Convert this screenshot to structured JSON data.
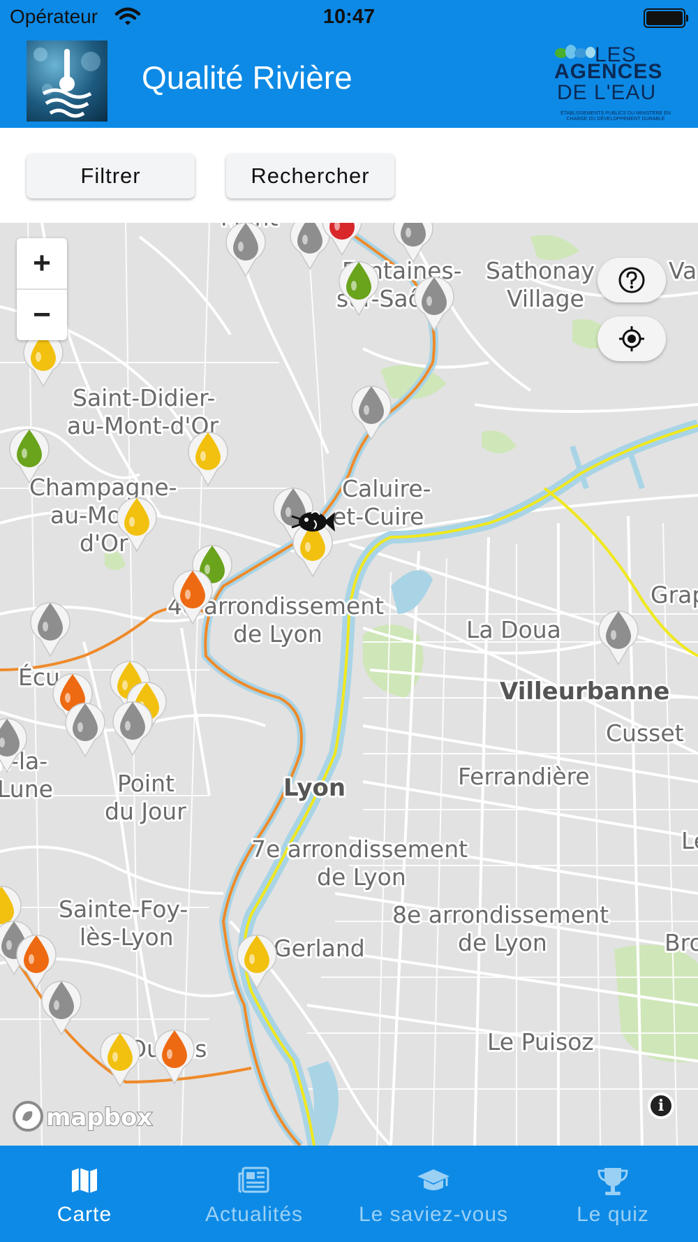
{
  "status_bar": {
    "carrier": "Opérateur",
    "time": "10:47"
  },
  "header": {
    "title": "Qualité Rivière",
    "logo": {
      "line1": "LES",
      "line2": "AGENCES",
      "line3": "DE L'EAU",
      "tagline": "ÉTABLISSEMENTS PUBLICS DU MINISTÈRE EN CHARGE DU DÉVELOPPEMENT DURABLE"
    }
  },
  "toolbar": {
    "filter_label": "Filtrer",
    "search_label": "Rechercher"
  },
  "map": {
    "zoom_in": "+",
    "zoom_out": "−",
    "attribution": "mapbox",
    "labels": [
      "Mont-",
      "Fontaines-",
      "sur-Saône",
      "Sathonay",
      "Village",
      "Va",
      "Saint-Didier-",
      "au-Mont-d'Or",
      "Champagne-",
      "au-Mont-",
      "d'Or",
      "Caluire-",
      "et-Cuire",
      "4e arrondissement",
      "de Lyon",
      "La Doua",
      "Grap",
      "Villeurbanne",
      "Cusset",
      "Écu",
      "n-la-",
      "Lune",
      "Point",
      "du Jour",
      "Lyon",
      "Ferrandière",
      "Le",
      "7e arrondissement",
      "de Lyon",
      "Sainte-Foy-",
      "lès-Lyon",
      "8e arrondissement",
      "de Lyon",
      "Gerland",
      "Bro",
      "Oullins",
      "Le Puisoz"
    ],
    "marker_colors": {
      "green": "#6aa31c",
      "yellow": "#f2c10f",
      "orange": "#ee6a12",
      "grey": "#8e8e8e",
      "red": "#d8282a"
    }
  },
  "tabs": [
    {
      "label": "Carte",
      "icon": "map-icon",
      "active": true
    },
    {
      "label": "Actualités",
      "icon": "newspaper-icon",
      "active": false
    },
    {
      "label": "Le saviez-vous",
      "icon": "graduation-cap-icon",
      "active": false
    },
    {
      "label": "Le quiz",
      "icon": "trophy-icon",
      "active": false
    }
  ],
  "colors": {
    "brand_blue": "#0d8ae6",
    "river_orange": "#ee8a2a",
    "river_yellow": "#f0e81e",
    "water": "#a8d4e6"
  }
}
